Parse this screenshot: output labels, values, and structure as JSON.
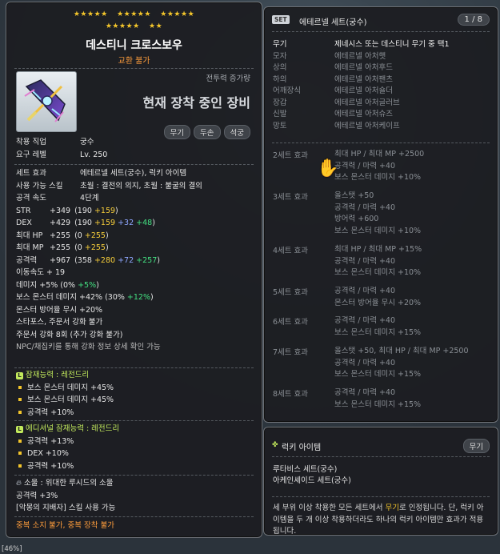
{
  "item": {
    "stars": [
      "★★★★★",
      "★★★★★",
      "★★★★★",
      "★★★★★",
      "★★"
    ],
    "name": "데스티니 크로스보우",
    "trade": "교환 불가",
    "combat_power_label": "전투력 증가량",
    "combat_power_value": "현재 장착 중인 장비",
    "tags": [
      "무기",
      "두손",
      "석궁"
    ],
    "job_label": "착용 직업",
    "job_value": "궁수",
    "level_label": "요구 레벨",
    "level_value": "Lv. 250",
    "set_effect_label": "세트 효과",
    "set_effect_value": "에테르넬 세트(궁수), 럭키 아이템",
    "skill_label": "사용 가능 스킬",
    "skill_value": "초월 : 결전의 의지, 초월 : 불굴의 결의",
    "speed_label": "공격 속도",
    "speed_value": "4단계",
    "stats": [
      {
        "label": "STR",
        "main": "+349",
        "paren_open": "(190 ",
        "a": "+159",
        "b": "",
        "c": "",
        "paren_close": ")"
      },
      {
        "label": "DEX",
        "main": "+429",
        "paren_open": "(190 ",
        "a": "+159",
        "b": " +32",
        "c": " +48",
        "paren_close": ")"
      },
      {
        "label": "최대 HP",
        "main": "+255",
        "paren_open": "(0 ",
        "a": "+255",
        "b": "",
        "c": "",
        "paren_close": ")"
      },
      {
        "label": "최대 MP",
        "main": "+255",
        "paren_open": "(0 ",
        "a": "+255",
        "b": "",
        "c": "",
        "paren_close": ")"
      },
      {
        "label": "공격력",
        "main": "+967",
        "paren_open": "(358 ",
        "a": "+280",
        "b": " +72",
        "c": " +257",
        "paren_close": ")"
      }
    ],
    "move_speed": "이동속도   + 19",
    "damage_main": "데미지  +5% (0% ",
    "damage_c": "+5%",
    "damage_close": ")",
    "boss_main": "보스 몬스터 데미지  +42% (30% ",
    "boss_c": "+12%",
    "boss_close": ")",
    "ignore_def": "몬스터 방어율 무시  +20%",
    "starforce": "스타포스, 주문서 강화 불가",
    "scroll": "주문서 강화 8회 (추가 강화 불가)",
    "npc_note": "NPC/채집키를 통해 강화 정보 상세 확인 가능",
    "potential_title": "잠재능력 : 레전드리",
    "potential_lines": [
      "보스 몬스터 데미지 +45%",
      "보스 몬스터 데미지 +45%",
      "공격력 +10%"
    ],
    "additional_title": "에디셔널 잠재능력 : 레전드리",
    "additional_lines": [
      "공격력 +13%",
      "DEX +10%",
      "공격력 +10%"
    ],
    "soul_title": "소울 : 위대한 루시드의 소울",
    "soul_stat": "공격력 +3%",
    "soul_skill": "[악몽의 지배자] 스킬 사용 가능",
    "duplicate": "중복 소지 불가, 중복 장착 불가"
  },
  "set": {
    "badge": "SET",
    "title": "에테르넬 세트(궁수)",
    "count": "1 / 8",
    "parts": [
      {
        "slot": "무기",
        "name": "제네시스 또는 데스티니 무기 중 택1",
        "on": true
      },
      {
        "slot": "모자",
        "name": "에테르넬 아처햇",
        "on": false
      },
      {
        "slot": "상의",
        "name": "에테르넬 아처후드",
        "on": false
      },
      {
        "slot": "하의",
        "name": "에테르넬 아처팬츠",
        "on": false
      },
      {
        "slot": "어깨장식",
        "name": "에테르넬 아처숄더",
        "on": false
      },
      {
        "slot": "장갑",
        "name": "에테르넬 아처글러브",
        "on": false
      },
      {
        "slot": "신발",
        "name": "에테르넬 아처슈즈",
        "on": false
      },
      {
        "slot": "망토",
        "name": "에테르넬 아처케이프",
        "on": false
      }
    ],
    "effects": [
      {
        "title": "2세트 효과",
        "lines": [
          "최대 HP / 최대 MP  +2500",
          "공격력 / 마력  +40",
          "보스 몬스터 데미지 +10%"
        ]
      },
      {
        "title": "3세트 효과",
        "lines": [
          "올스탯  +50",
          "공격력 / 마력  +40",
          "방어력  +600",
          "보스 몬스터 데미지 +10%"
        ]
      },
      {
        "title": "4세트 효과",
        "lines": [
          "최대 HP / 최대 MP  +15%",
          "공격력 / 마력  +40",
          "보스 몬스터 데미지 +10%"
        ]
      },
      {
        "title": "5세트 효과",
        "lines": [
          "공격력 / 마력  +40",
          "몬스터 방어율 무시 +20%"
        ]
      },
      {
        "title": "6세트 효과",
        "lines": [
          "공격력 / 마력  +40",
          "보스 몬스터 데미지 +15%"
        ]
      },
      {
        "title": "7세트 효과",
        "lines": [
          "올스탯  +50, 최대 HP / 최대 MP  +2500",
          "공격력 / 마력  +40",
          "보스 몬스터 데미지 +15%"
        ]
      },
      {
        "title": "8세트 효과",
        "lines": [
          "공격력 / 마력  +40",
          "보스 몬스터 데미지 +15%"
        ]
      }
    ]
  },
  "lucky": {
    "title": "럭키 아이템",
    "tag": "무기",
    "sets": [
      "루타비스 세트(궁수)",
      "아케인셰이드 세트(궁수)"
    ],
    "desc_a": "세 부위 이상 착용한 모든 세트에서 ",
    "desc_hl": "무기",
    "desc_b": "로 인정됩니다. 단, 럭키 아이템을 두 개 이상 착용하더라도 하나의 럭키 아이템만 효과가 적용됩니다."
  },
  "footer": {
    "text": "[46%]"
  }
}
